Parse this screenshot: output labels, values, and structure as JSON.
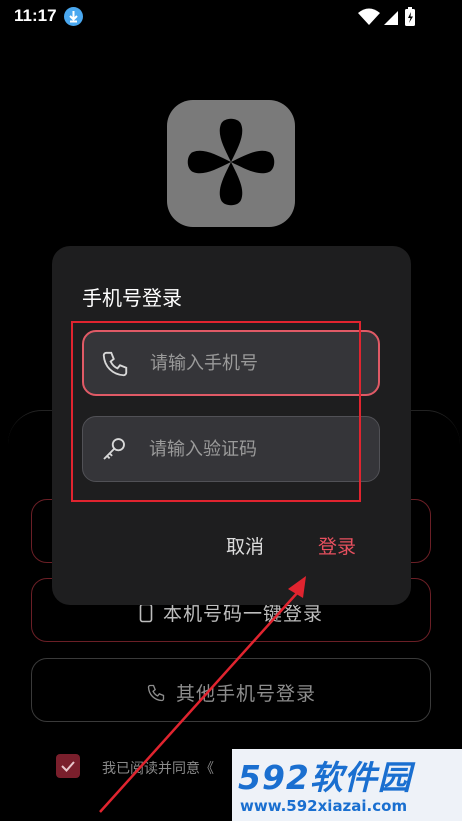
{
  "status_bar": {
    "time": "11:17"
  },
  "background": {
    "onekey_label": "本机号码一键登录",
    "other_label": "其他手机号登录",
    "agree_text": "我已阅读并同意《"
  },
  "dialog": {
    "title": "手机号登录",
    "phone_placeholder": "请输入手机号",
    "code_placeholder": "请输入验证码",
    "cancel_label": "取消",
    "login_label": "登录"
  },
  "watermark": {
    "brand": "592软件园",
    "url": "www.592xiazai.com"
  },
  "colors": {
    "accent": "#e8505f",
    "annotation": "#e0242f",
    "watermark": "#1a6fd0"
  },
  "icons": [
    "download-icon",
    "wifi-icon",
    "signal-icon",
    "battery-icon",
    "app-logo-icon",
    "phone-icon",
    "key-icon",
    "mobile-icon",
    "checkmark-icon"
  ]
}
